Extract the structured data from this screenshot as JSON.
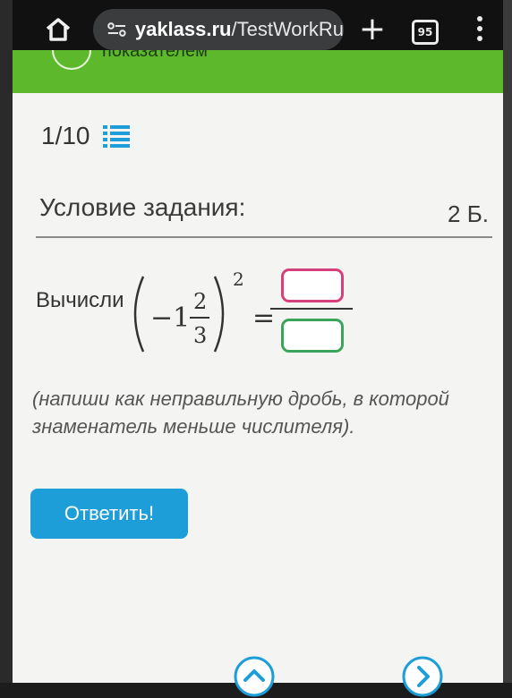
{
  "browser": {
    "url_domain": "yaklass.ru",
    "url_path": "/TestWorkRu",
    "tab_count": "95"
  },
  "banner": {
    "text": "показателем"
  },
  "progress": {
    "text": "1/10"
  },
  "task": {
    "heading": "Условие задания:",
    "points": "2 Б.",
    "prompt": "Вычисли",
    "formula": {
      "sign": "−1",
      "numerator": "2",
      "denominator": "3",
      "exponent": "2",
      "equals": "="
    },
    "hint": "(напиши как неправильную дробь, в которой знаменатель меньше числителя)."
  },
  "answer": {
    "numerator_value": "",
    "denominator_value": ""
  },
  "buttons": {
    "submit": "Ответить!"
  },
  "colors": {
    "green_bar": "#5db82c",
    "button": "#1e9ed8",
    "numerator_border": "#d6407a",
    "denominator_border": "#3aa55a",
    "nav_accent": "#1e9ed8"
  },
  "icons": {
    "home": "home-icon",
    "settings": "site-settings-icon",
    "new_tab": "plus-icon",
    "tabs": "tab-switcher-icon",
    "menu": "more-vert-icon",
    "list": "list-icon",
    "prev": "chevron-up-icon",
    "next": "chevron-right-icon"
  }
}
